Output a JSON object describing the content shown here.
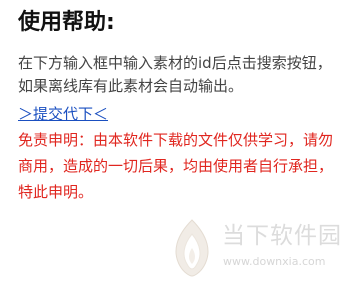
{
  "help": {
    "title": "使用帮助:",
    "description_lines": [
      "在下方输入框中输入素材的id后点击搜索按钮，",
      "如果离线库有此素材会自动输出。"
    ],
    "submit_link": "＞提交代下＜",
    "disclaimer_lines": [
      "免责申明：由本软件下载的文件仅供学习，请勿",
      "商用，造成的一切后果，均由使用者自行承担，",
      "特此申明。"
    ]
  },
  "watermark": {
    "brand": "当下软件园",
    "url": "www.downxia.com"
  },
  "colors": {
    "title": "#111111",
    "description": "#444444",
    "link": "#1a4fc0",
    "disclaimer": "#e0261f",
    "watermark": "#dcdcdc"
  }
}
